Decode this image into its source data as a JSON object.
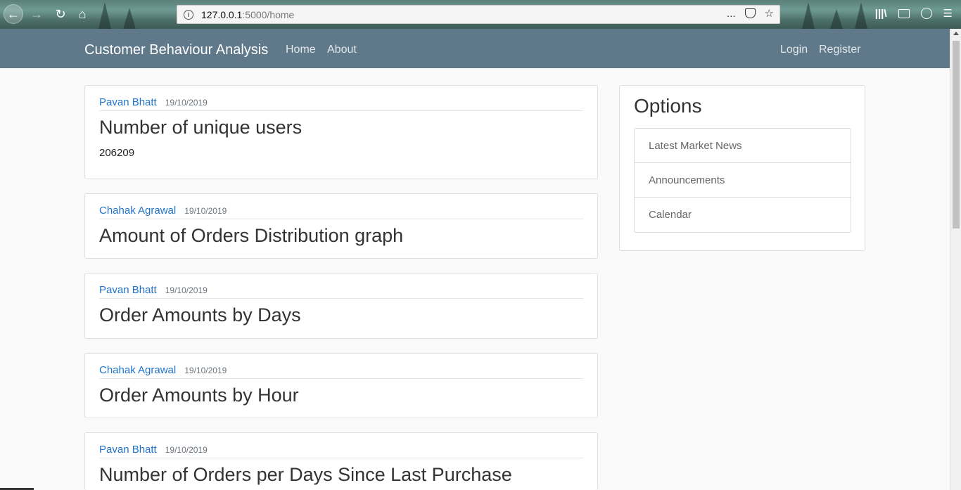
{
  "browser": {
    "url_host": "127.0.0.1",
    "url_path": ":5000/home",
    "more_icon": "...",
    "bookmark_icon": "☆"
  },
  "site": {
    "brand": "Customer Behaviour Analysis",
    "nav_left": [
      "Home",
      "About"
    ],
    "nav_right": [
      "Login",
      "Register"
    ]
  },
  "posts": [
    {
      "author": "Pavan Bhatt",
      "date": "19/10/2019",
      "title": "Number of unique users",
      "content": "206209"
    },
    {
      "author": "Chahak Agrawal",
      "date": "19/10/2019",
      "title": "Amount of Orders Distribution graph"
    },
    {
      "author": "Pavan Bhatt",
      "date": "19/10/2019",
      "title": "Order Amounts by Days"
    },
    {
      "author": "Chahak Agrawal",
      "date": "19/10/2019",
      "title": "Order Amounts by Hour"
    },
    {
      "author": "Pavan Bhatt",
      "date": "19/10/2019",
      "title": "Number of Orders per Days Since Last Purchase"
    }
  ],
  "sidebar": {
    "title": "Options",
    "items": [
      "Latest Market News",
      "Announcements",
      "Calendar"
    ]
  }
}
